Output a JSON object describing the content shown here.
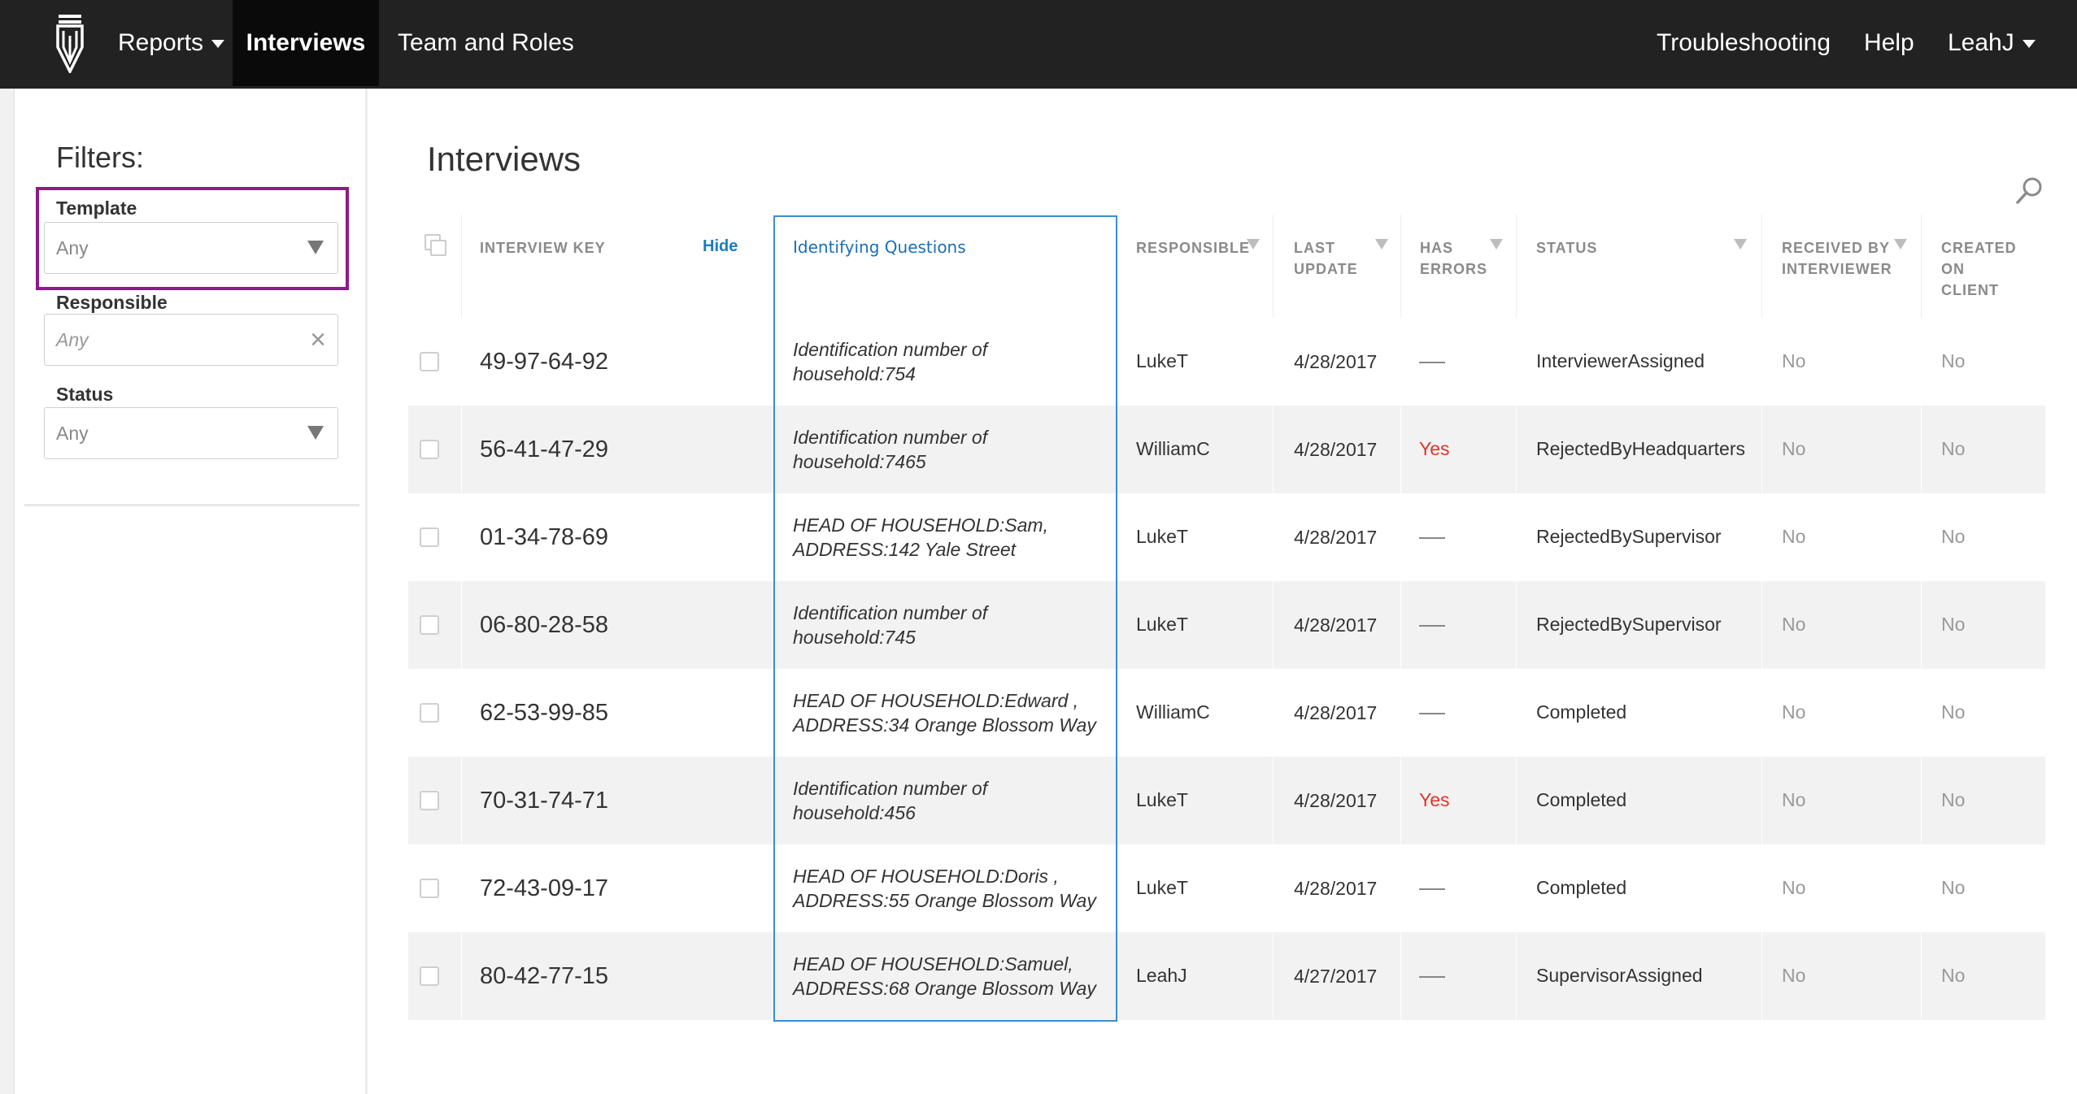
{
  "nav": {
    "reports": "Reports",
    "interviews": "Interviews",
    "team_roles": "Team and Roles",
    "troubleshooting": "Troubleshooting",
    "help": "Help",
    "user": "LeahJ"
  },
  "sidebar": {
    "title": "Filters:",
    "template": {
      "label": "Template",
      "value": "Any"
    },
    "responsible": {
      "label": "Responsible",
      "placeholder": "Any"
    },
    "status": {
      "label": "Status",
      "value": "Any"
    }
  },
  "main": {
    "title": "Interviews",
    "hide_link": "Hide",
    "columns": {
      "key": "INTERVIEW KEY",
      "identifying": "Identifying Questions",
      "responsible": "RESPONSIBLE",
      "last_update": [
        "LAST",
        "UPDATE"
      ],
      "has_errors": [
        "HAS",
        "ERRORS"
      ],
      "status": "STATUS",
      "received": [
        "RECEIVED BY",
        "INTERVIEWER"
      ],
      "created": [
        "CREATED",
        "ON",
        "CLIENT"
      ]
    },
    "rows": [
      {
        "key": "49-97-64-92",
        "iq": [
          "Identification number of",
          "household:754"
        ],
        "responsible": "LukeT",
        "date": "4/28/2017",
        "errors": "",
        "status": "InterviewerAssigned",
        "received": "No",
        "client": "No"
      },
      {
        "key": "56-41-47-29",
        "iq": [
          "Identification number of",
          "household:7465"
        ],
        "responsible": "WilliamC",
        "date": "4/28/2017",
        "errors": "Yes",
        "status": "RejectedByHeadquarters",
        "received": "No",
        "client": "No"
      },
      {
        "key": "01-34-78-69",
        "iq": [
          "HEAD OF HOUSEHOLD:Sam,",
          "ADDRESS:142 Yale Street"
        ],
        "responsible": "LukeT",
        "date": "4/28/2017",
        "errors": "",
        "status": "RejectedBySupervisor",
        "received": "No",
        "client": "No"
      },
      {
        "key": "06-80-28-58",
        "iq": [
          "Identification number of",
          "household:745"
        ],
        "responsible": "LukeT",
        "date": "4/28/2017",
        "errors": "",
        "status": "RejectedBySupervisor",
        "received": "No",
        "client": "No"
      },
      {
        "key": "62-53-99-85",
        "iq": [
          "HEAD OF HOUSEHOLD:Edward ,",
          "ADDRESS:34 Orange Blossom Way"
        ],
        "responsible": "WilliamC",
        "date": "4/28/2017",
        "errors": "",
        "status": "Completed",
        "received": "No",
        "client": "No"
      },
      {
        "key": "70-31-74-71",
        "iq": [
          "Identification number of",
          "household:456"
        ],
        "responsible": "LukeT",
        "date": "4/28/2017",
        "errors": "Yes",
        "status": "Completed",
        "received": "No",
        "client": "No"
      },
      {
        "key": "72-43-09-17",
        "iq": [
          "HEAD OF HOUSEHOLD:Doris ,",
          "ADDRESS:55 Orange Blossom Way"
        ],
        "responsible": "LukeT",
        "date": "4/28/2017",
        "errors": "",
        "status": "Completed",
        "received": "No",
        "client": "No"
      },
      {
        "key": "80-42-77-15",
        "iq": [
          "HEAD OF HOUSEHOLD:Samuel,",
          "ADDRESS:68 Orange Blossom Way"
        ],
        "responsible": "LeahJ",
        "date": "4/27/2017",
        "errors": "",
        "status": "SupervisorAssigned",
        "received": "No",
        "client": "No"
      }
    ]
  },
  "colors": {
    "navbar": "#222222",
    "active_tab": "#0a0a0a",
    "highlight": "#8e1a8a",
    "link": "#1a7cc1",
    "error": "#e0352b"
  },
  "icons": {
    "logo": "pen-nib-logo",
    "search": "search-icon"
  }
}
